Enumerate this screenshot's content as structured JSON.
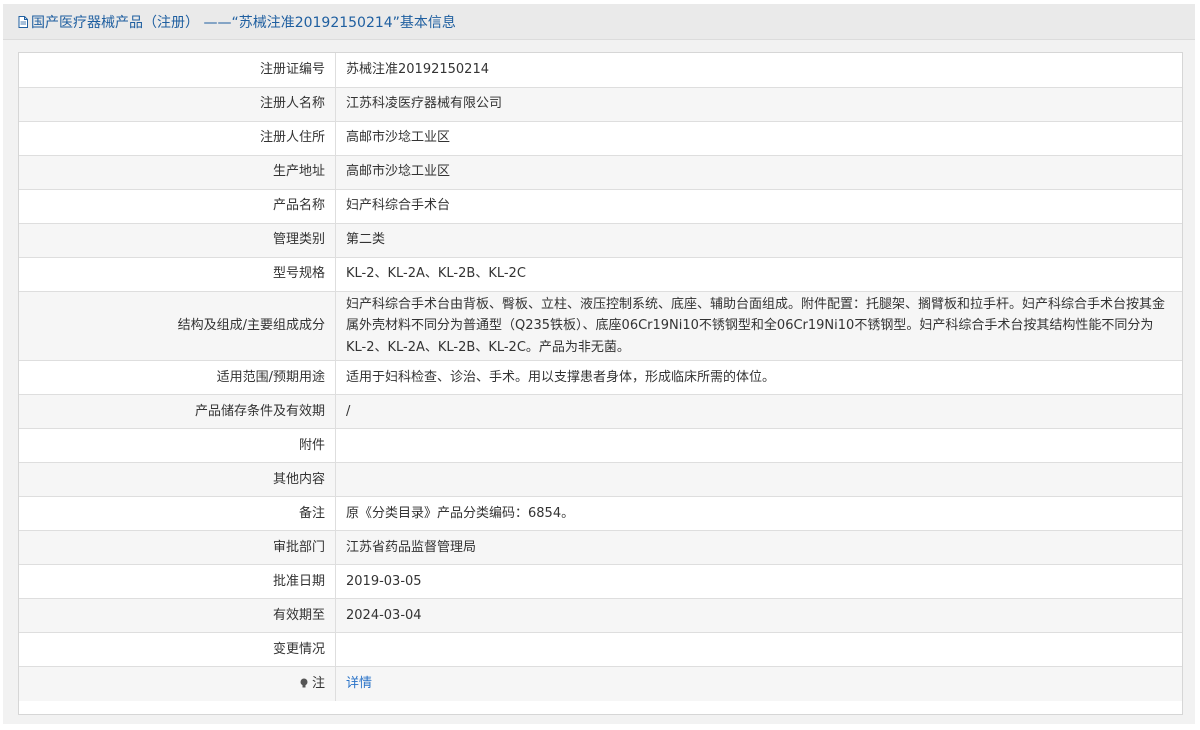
{
  "header": {
    "title": "国产医疗器械产品（注册） ——“苏械注准20192150214”基本信息",
    "icon": "document-icon"
  },
  "rows": [
    {
      "label": "注册证编号",
      "value": "苏械注准20192150214"
    },
    {
      "label": "注册人名称",
      "value": "江苏科凌医疗器械有限公司"
    },
    {
      "label": "注册人住所",
      "value": "高邮市沙埝工业区"
    },
    {
      "label": "生产地址",
      "value": "高邮市沙埝工业区"
    },
    {
      "label": "产品名称",
      "value": "妇产科综合手术台"
    },
    {
      "label": "管理类别",
      "value": "第二类"
    },
    {
      "label": "型号规格",
      "value": "KL-2、KL-2A、KL-2B、KL-2C"
    },
    {
      "label": "结构及组成/主要组成成分",
      "value": "妇产科综合手术台由背板、臀板、立柱、液压控制系统、底座、辅助台面组成。附件配置：托腿架、搁臂板和拉手杆。妇产科综合手术台按其金属外壳材料不同分为普通型（Q235铁板）、底座06Cr19Ni10不锈钢型和全06Cr19Ni10不锈钢型。妇产科综合手术台按其结构性能不同分为KL-2、KL-2A、KL-2B、KL-2C。产品为非无菌。"
    },
    {
      "label": "适用范围/预期用途",
      "value": "适用于妇科检查、诊治、手术。用以支撑患者身体，形成临床所需的体位。"
    },
    {
      "label": "产品储存条件及有效期",
      "value": "/"
    },
    {
      "label": "附件",
      "value": ""
    },
    {
      "label": "其他内容",
      "value": ""
    },
    {
      "label": "备注",
      "value": "原《分类目录》产品分类编码：6854。"
    },
    {
      "label": "审批部门",
      "value": "江苏省药品监督管理局"
    },
    {
      "label": "批准日期",
      "value": "2019-03-05"
    },
    {
      "label": "有效期至",
      "value": "2024-03-04"
    },
    {
      "label": "变更情况",
      "value": ""
    },
    {
      "label": "注",
      "value": "详情",
      "icon": "lightbulb-icon"
    }
  ],
  "colors": {
    "link": "#2a73c8",
    "title": "#1f5fa0"
  }
}
